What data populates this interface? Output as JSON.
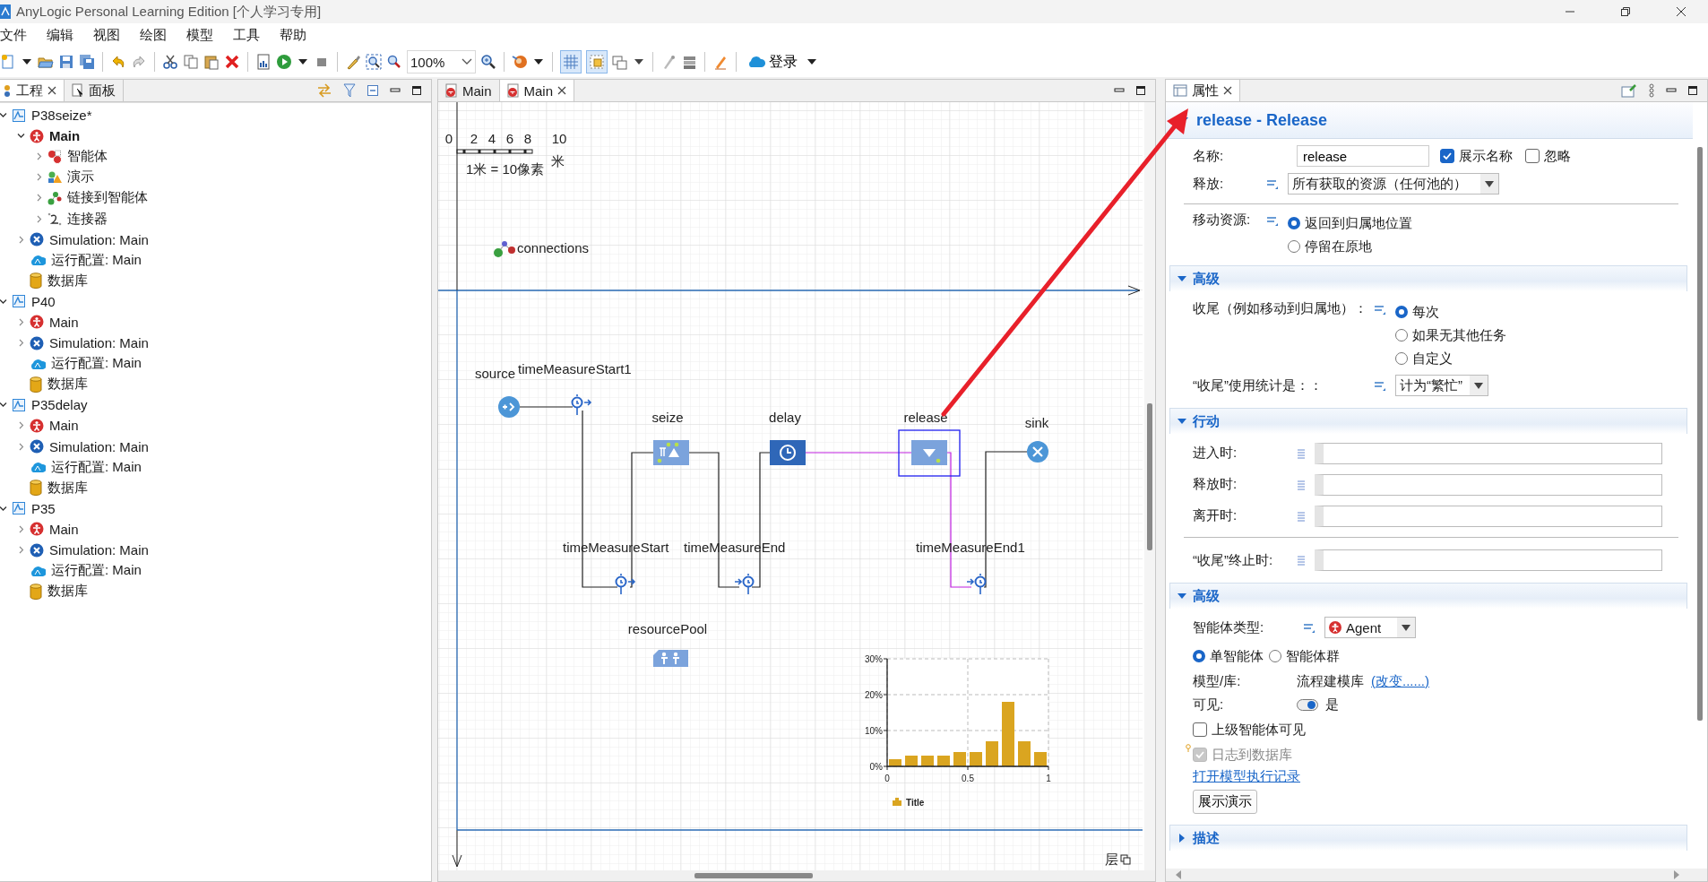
{
  "window": {
    "title": "AnyLogic Personal Learning Edition [个人学习专用]"
  },
  "menu": [
    "文件",
    "编辑",
    "视图",
    "绘图",
    "模型",
    "工具",
    "帮助"
  ],
  "toolbar": {
    "zoom": "100%",
    "grid_on": true,
    "snap_on": true,
    "login": "登录"
  },
  "project_panel": {
    "tabs": [
      {
        "label": "工程",
        "selected": true
      },
      {
        "label": "面板",
        "selected": false
      }
    ],
    "tree": [
      {
        "label": "P38seize*",
        "kind": "project",
        "expanded": true,
        "children": [
          {
            "label": "Main",
            "kind": "agent",
            "expanded": true,
            "active": true,
            "children": [
              {
                "label": "智能体",
                "kind": "agents",
                "expanded": false
              },
              {
                "label": "演示",
                "kind": "presentation",
                "expanded": false
              },
              {
                "label": "链接到智能体",
                "kind": "links",
                "expanded": false
              },
              {
                "label": "连接器",
                "kind": "connectors",
                "expanded": false
              }
            ]
          },
          {
            "label": "Simulation: Main",
            "kind": "simulation",
            "expanded": false
          },
          {
            "label": "运行配置: Main",
            "kind": "run-config"
          },
          {
            "label": "数据库",
            "kind": "database"
          }
        ]
      },
      {
        "label": "P40",
        "kind": "project",
        "expanded": true,
        "children": [
          {
            "label": "Main",
            "kind": "agent",
            "expanded": false,
            "active": false
          },
          {
            "label": "Simulation: Main",
            "kind": "simulation",
            "expanded": false
          },
          {
            "label": "运行配置: Main",
            "kind": "run-config"
          },
          {
            "label": "数据库",
            "kind": "database"
          }
        ]
      },
      {
        "label": "P35delay",
        "kind": "project",
        "expanded": true,
        "children": [
          {
            "label": "Main",
            "kind": "agent",
            "expanded": false,
            "active": false
          },
          {
            "label": "Simulation: Main",
            "kind": "simulation",
            "expanded": false
          },
          {
            "label": "运行配置: Main",
            "kind": "run-config"
          },
          {
            "label": "数据库",
            "kind": "database"
          }
        ]
      },
      {
        "label": "P35",
        "kind": "project",
        "expanded": true,
        "children": [
          {
            "label": "Main",
            "kind": "agent",
            "expanded": false,
            "active": false
          },
          {
            "label": "Simulation: Main",
            "kind": "simulation",
            "expanded": false
          },
          {
            "label": "运行配置: Main",
            "kind": "run-config"
          },
          {
            "label": "数据库",
            "kind": "database"
          }
        ]
      }
    ]
  },
  "editor": {
    "tabs": [
      {
        "label": "Main",
        "selected": false
      },
      {
        "label": "Main",
        "selected": true
      }
    ],
    "scale": {
      "ticks": [
        "0",
        "2",
        "4",
        "6",
        "8",
        "10"
      ],
      "unit": "米",
      "caption": "1米 = 10像素"
    },
    "connections_label": "connections",
    "blocks": [
      {
        "name": "source",
        "kind": "source",
        "selected": false
      },
      {
        "name": "timeMeasureStart1",
        "kind": "time-measure-start",
        "selected": false
      },
      {
        "name": "seize",
        "kind": "seize",
        "selected": false
      },
      {
        "name": "delay",
        "kind": "delay",
        "selected": false
      },
      {
        "name": "release",
        "kind": "release",
        "selected": true
      },
      {
        "name": "sink",
        "kind": "sink",
        "selected": false
      },
      {
        "name": "timeMeasureStart",
        "kind": "time-measure-start",
        "selected": false
      },
      {
        "name": "timeMeasureEnd",
        "kind": "time-measure-end",
        "selected": false
      },
      {
        "name": "timeMeasureEnd1",
        "kind": "time-measure-end",
        "selected": false
      }
    ],
    "resource_pool": "resourcePool",
    "layers_label": "层",
    "chart_data": {
      "type": "bar",
      "grid": true,
      "x": [
        0.05,
        0.15,
        0.25,
        0.35,
        0.45,
        0.55,
        0.65,
        0.75,
        0.85,
        0.95
      ],
      "xlim": [
        0,
        1
      ],
      "ylim": [
        0,
        0.3
      ],
      "xticks": [
        0,
        0.5,
        1
      ],
      "yticks": [
        {
          "value": 0,
          "label": "0%"
        },
        {
          "value": 0.1,
          "label": "10%"
        },
        {
          "value": 0.2,
          "label": "20%"
        },
        {
          "value": 0.3,
          "label": "30%"
        }
      ],
      "series": [
        {
          "name": "Title",
          "color": "#daa520",
          "values": [
            0.02,
            0.03,
            0.03,
            0.03,
            0.04,
            0.04,
            0.07,
            0.18,
            0.07,
            0.04
          ]
        }
      ]
    }
  },
  "properties": {
    "tab": {
      "label": "属性",
      "selected": true
    },
    "heading": {
      "text": "release - Release",
      "expanded": true
    },
    "name": {
      "label": "名称:",
      "value": "release"
    },
    "show_name": {
      "label": "展示名称",
      "checked": true
    },
    "ignore": {
      "label": "忽略",
      "checked": false
    },
    "release": {
      "label": "释放:",
      "value": "所有获取的资源（任何池的）"
    },
    "move": {
      "label": "移动资源:",
      "options": [
        {
          "label": "返回到归属地位置",
          "selected": true
        },
        {
          "label": "停留在原地",
          "selected": false
        }
      ]
    },
    "advanced": {
      "title": "高级",
      "expanded": true,
      "wrapup": {
        "label": "收尾（例如移动到归属地）：",
        "options": [
          {
            "label": "每次",
            "selected": true
          },
          {
            "label": "如果无其他任务",
            "selected": false
          },
          {
            "label": "自定义",
            "selected": false
          }
        ]
      },
      "stats": {
        "label": "“收尾”使用统计是：：",
        "value": "计为“繁忙”"
      }
    },
    "actions": {
      "title": "行动",
      "expanded": true,
      "fields": [
        {
          "label": "进入时:"
        },
        {
          "label": "释放时:"
        },
        {
          "label": "离开时:"
        }
      ],
      "wrapup_end": {
        "label": "“收尾”终止时:"
      }
    },
    "advanced2": {
      "title": "高级",
      "expanded": true,
      "agent_type": {
        "label": "智能体类型:",
        "value": "Agent"
      },
      "population": [
        {
          "label": "单智能体",
          "selected": true
        },
        {
          "label": "智能体群",
          "selected": false
        }
      ],
      "library": {
        "label": "模型/库:",
        "value": "流程建模库",
        "link": "(改变......)"
      },
      "visible": {
        "label": "可见:",
        "on": true,
        "value": "是"
      },
      "upper_visible": {
        "label": "上级智能体可见",
        "checked": false
      },
      "log": {
        "label": "日志到数据库",
        "checked": true,
        "disabled": true
      },
      "log_link": "打开模型执行记录",
      "show_button": "展示演示"
    },
    "description": {
      "title": "描述",
      "expanded": false
    }
  }
}
